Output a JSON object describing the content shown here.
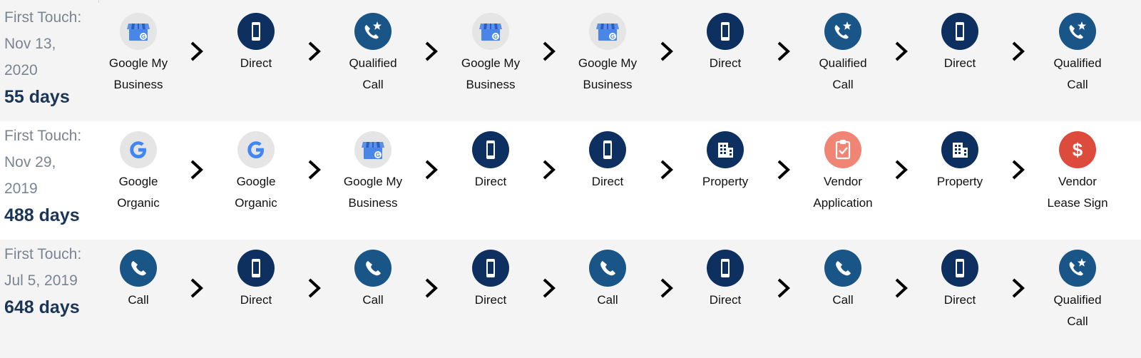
{
  "journeys": [
    {
      "first_touch_label": "First Touch:",
      "date_line1": "Nov 13,",
      "date_line2": "2020",
      "duration": "55 days",
      "steps": [
        {
          "icon": "google-my-business-icon",
          "l1": "Google My",
          "l2": "Business"
        },
        {
          "icon": "mobile-phone-icon",
          "l1": "Direct",
          "l2": ""
        },
        {
          "icon": "qualified-call-icon",
          "l1": "Qualified",
          "l2": "Call"
        },
        {
          "icon": "google-my-business-icon",
          "l1": "Google My",
          "l2": "Business"
        },
        {
          "icon": "google-my-business-icon",
          "l1": "Google My",
          "l2": "Business"
        },
        {
          "icon": "mobile-phone-icon",
          "l1": "Direct",
          "l2": ""
        },
        {
          "icon": "qualified-call-icon",
          "l1": "Qualified",
          "l2": "Call"
        },
        {
          "icon": "mobile-phone-icon",
          "l1": "Direct",
          "l2": ""
        },
        {
          "icon": "qualified-call-icon",
          "l1": "Qualified",
          "l2": "Call"
        }
      ]
    },
    {
      "first_touch_label": "First Touch:",
      "date_line1": "Nov 29,",
      "date_line2": "2019",
      "duration": "488 days",
      "steps": [
        {
          "icon": "google-g-icon",
          "l1": "Google",
          "l2": "Organic"
        },
        {
          "icon": "google-g-icon",
          "l1": "Google",
          "l2": "Organic"
        },
        {
          "icon": "google-my-business-icon",
          "l1": "Google My",
          "l2": "Business"
        },
        {
          "icon": "mobile-phone-icon",
          "l1": "Direct",
          "l2": ""
        },
        {
          "icon": "mobile-phone-icon",
          "l1": "Direct",
          "l2": ""
        },
        {
          "icon": "building-icon",
          "l1": "Property",
          "l2": ""
        },
        {
          "icon": "clipboard-check-icon",
          "l1": "Vendor",
          "l2": "Application"
        },
        {
          "icon": "building-icon",
          "l1": "Property",
          "l2": ""
        },
        {
          "icon": "dollar-icon",
          "l1": "Vendor",
          "l2": "Lease Sign"
        }
      ]
    },
    {
      "first_touch_label": "First Touch:",
      "date_line1": "Jul 5, 2019",
      "date_line2": "",
      "duration": "648 days",
      "steps": [
        {
          "icon": "phone-call-icon",
          "l1": "Call",
          "l2": ""
        },
        {
          "icon": "mobile-phone-icon",
          "l1": "Direct",
          "l2": ""
        },
        {
          "icon": "phone-call-icon",
          "l1": "Call",
          "l2": ""
        },
        {
          "icon": "mobile-phone-icon",
          "l1": "Direct",
          "l2": ""
        },
        {
          "icon": "phone-call-icon",
          "l1": "Call",
          "l2": ""
        },
        {
          "icon": "mobile-phone-icon",
          "l1": "Direct",
          "l2": ""
        },
        {
          "icon": "phone-call-icon",
          "l1": "Call",
          "l2": ""
        },
        {
          "icon": "mobile-phone-icon",
          "l1": "Direct",
          "l2": ""
        },
        {
          "icon": "qualified-call-icon",
          "l1": "Qualified",
          "l2": "Call"
        }
      ]
    }
  ]
}
